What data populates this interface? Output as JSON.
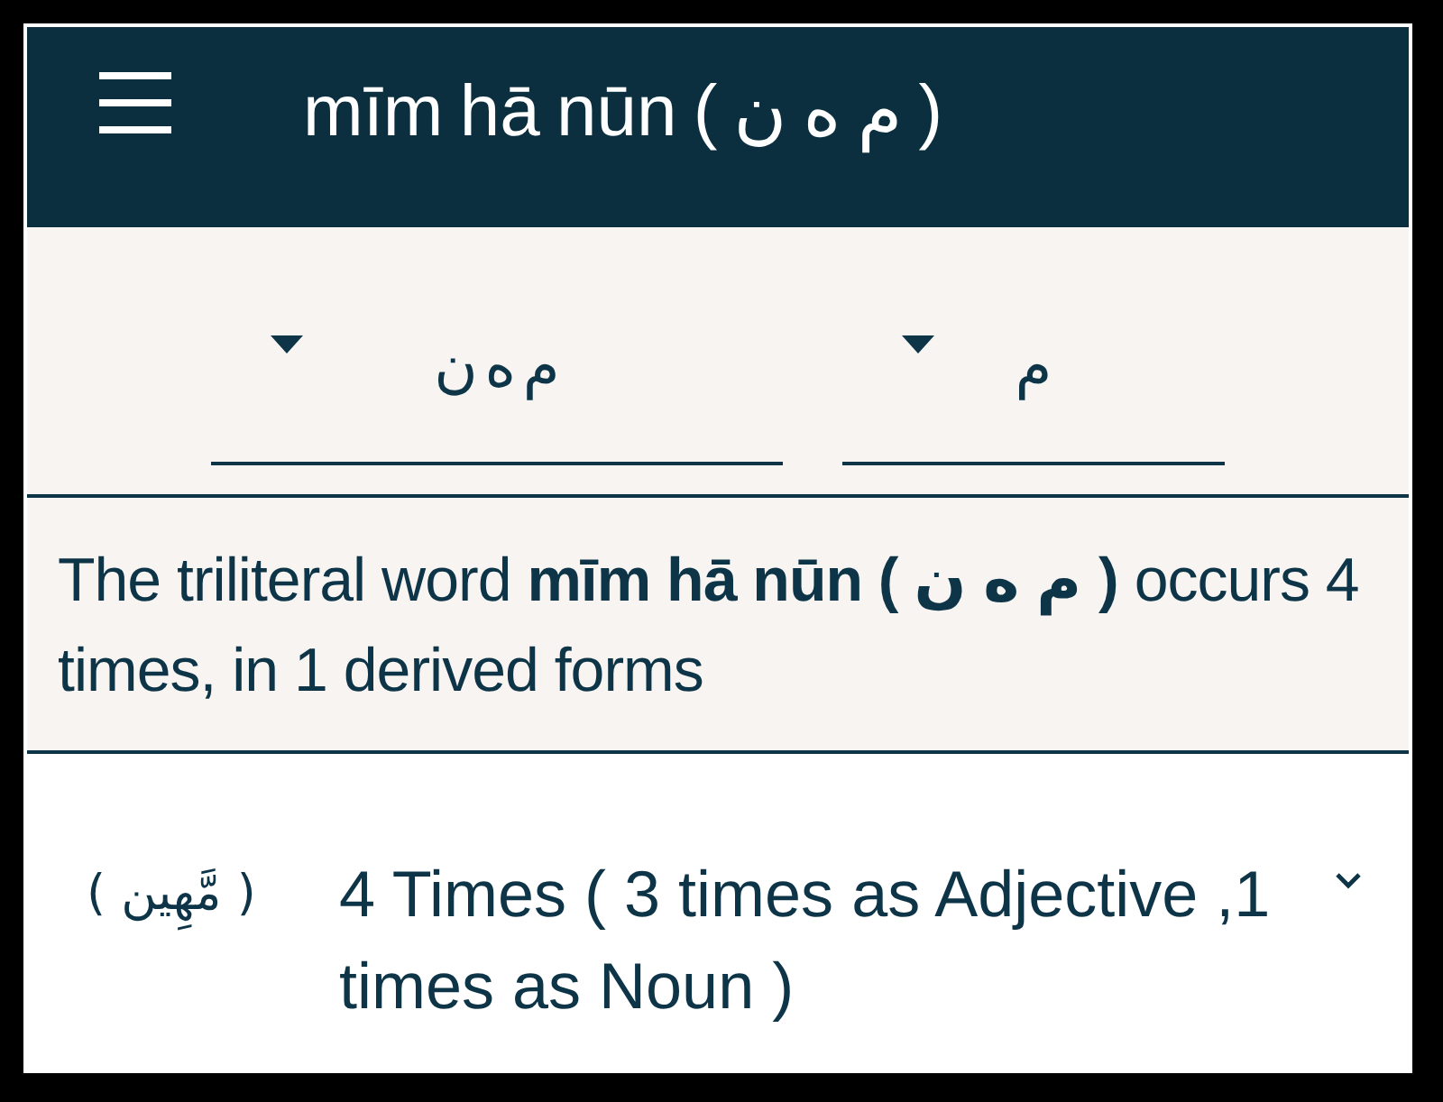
{
  "app_bar": {
    "title": "mīm hā nūn ( م ه ن )"
  },
  "filters": [
    {
      "value": "م"
    },
    {
      "value": "م ه ن"
    }
  ],
  "summary": "The triliteral word **mīm hā nūn ( م ه ن )** occurs 4 times, in 1 derived forms",
  "derived_forms": [
    {
      "arabic": "( مَّهِين )",
      "description": "4 Times ( 3 times as Adjective ,1 times as Noun )",
      "expanded": false
    }
  ]
}
